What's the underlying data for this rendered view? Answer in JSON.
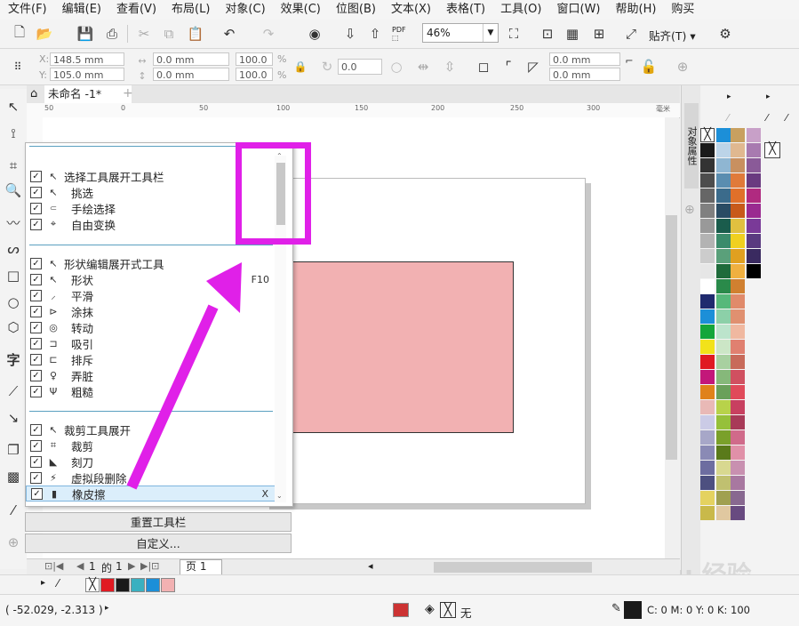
{
  "menu": [
    "文件(F)",
    "编辑(E)",
    "查看(V)",
    "布局(L)",
    "对象(C)",
    "效果(C)",
    "位图(B)",
    "文本(X)",
    "表格(T)",
    "工具(O)",
    "窗口(W)",
    "帮助(H)",
    "购买"
  ],
  "toolbar": {
    "pdf_label": "PDF",
    "zoom_value": "46%",
    "snap_label": "贴齐(T)"
  },
  "propbar": {
    "x_label": "X:",
    "x_value": "148.5 mm",
    "y_label": "Y:",
    "y_value": "105.0 mm",
    "w_value": "0.0 mm",
    "h_value": "0.0 mm",
    "sx_value": "100.0",
    "sy_value": "100.0",
    "pct": "%",
    "angle_value": "0.0",
    "corner1_value": "0.0 mm",
    "corner2_value": "0.0 mm"
  },
  "doc_tab": "未命名 -1*",
  "ruler_h": [
    "50",
    "0",
    "50",
    "100",
    "150",
    "200",
    "250",
    "300"
  ],
  "ruler_unit": "毫米",
  "dropdown": {
    "groups": [
      {
        "title": "选择工具展开工具栏",
        "items": [
          {
            "label": "挑选",
            "icon": "↖",
            "key": ""
          },
          {
            "label": "手绘选择",
            "icon": "⸦",
            "key": ""
          },
          {
            "label": "自由变换",
            "icon": "⌖",
            "key": ""
          }
        ]
      },
      {
        "title": "形状编辑展开式工具",
        "items": [
          {
            "label": "形状",
            "icon": "↖",
            "key": "F10"
          },
          {
            "label": "平滑",
            "icon": "⸝",
            "key": ""
          },
          {
            "label": "涂抹",
            "icon": "⊳",
            "key": ""
          },
          {
            "label": "转动",
            "icon": "◎",
            "key": ""
          },
          {
            "label": "吸引",
            "icon": "⊐",
            "key": ""
          },
          {
            "label": "排斥",
            "icon": "⊏",
            "key": ""
          },
          {
            "label": "弄脏",
            "icon": "♀",
            "key": ""
          },
          {
            "label": "粗糙",
            "icon": "Ψ",
            "key": ""
          }
        ]
      },
      {
        "title": "裁剪工具展开",
        "items": [
          {
            "label": "裁剪",
            "icon": "⌗",
            "key": ""
          },
          {
            "label": "刻刀",
            "icon": "◣",
            "key": ""
          },
          {
            "label": "虚拟段删除",
            "icon": "⚡",
            "key": ""
          },
          {
            "label": "橡皮擦",
            "icon": "▮",
            "key": "X"
          }
        ]
      }
    ],
    "reset_label": "重置工具栏",
    "customize_label": "自定义..."
  },
  "docker_label": "对象属性",
  "pagebar": {
    "page_num": "1",
    "of": "的",
    "total": "1",
    "page_tab": "页 1"
  },
  "status": {
    "coords": "( -52.029, -2.313 )",
    "fill_label": "无",
    "outline": "C: 0 M: 0 Y: 0 K: 100"
  },
  "watermark": "Baidu 经验",
  "colors": {
    "highlight": "#e020e8",
    "rect_fill": "#f2b1b2",
    "menu_bg": "#f5f5f5"
  },
  "palette_cols": [
    [
      "#ffffff",
      "#1a1a1a",
      "#333333",
      "#4d4d4d",
      "#666666",
      "#808080",
      "#999999",
      "#b3b3b3",
      "#cccccc",
      "#e6e6e6",
      "#ffffff",
      "#1f2a6e",
      "#1c8fd8",
      "#14a63a",
      "#f2e21a",
      "#e01a22",
      "#c3177a",
      "#e0821a",
      "#e9b9b6",
      "#cbcbe6",
      "#a7a7c8",
      "#8a8ab5",
      "#6d6da0",
      "#4d5080",
      "#e4d260",
      "#c9b94a"
    ],
    [
      "#1c8fd8",
      "#bcd4e8",
      "#8fb6d2",
      "#5a8db0",
      "#3b6b8b",
      "#2a4c64",
      "#1a5c4c",
      "#3b8b6b",
      "#5aa07a",
      "#1f6b3b",
      "#2a8a4a",
      "#56b87a",
      "#8cd0a8",
      "#bce4cc",
      "#cce6c6",
      "#a8d0a0",
      "#86b87a",
      "#6aa05a",
      "#b8d24a",
      "#96c03a",
      "#7aa02a",
      "#5a7a1a",
      "#d8d890",
      "#c0c070",
      "#a0a050",
      "#e0c8a0"
    ],
    [
      "#c8a060",
      "#e0b890",
      "#c89060",
      "#e07a3a",
      "#e0702a",
      "#c85a1a",
      "#e0c040",
      "#f0d020",
      "#e0a020",
      "#f0b040",
      "#d08030",
      "#e08a6a",
      "#e09070",
      "#f0b8a0",
      "#e08070",
      "#c86a5a",
      "#d05060",
      "#e04a5a",
      "#c84060",
      "#a83a58",
      "#d06a8a",
      "#e090a8",
      "#c890b0",
      "#a878a0",
      "#886890",
      "#684a80"
    ],
    [
      "#c8a0c8",
      "#a87ab0",
      "#8a5a98",
      "#6a3a80",
      "#b02a80",
      "#9a2a90",
      "#7a3a98",
      "#5a3a80",
      "#3a2a60",
      "#000000"
    ]
  ],
  "bottom_palette": [
    "#ffffff",
    "#e01a22",
    "#1a1a1a",
    "#3ab0c0",
    "#1c8fd8",
    "#f2b1b2"
  ]
}
